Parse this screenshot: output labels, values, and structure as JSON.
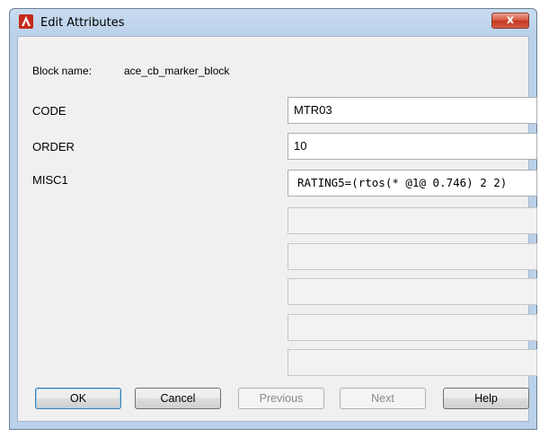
{
  "window": {
    "title": "Edit Attributes",
    "close_label": "x",
    "app_icon": "autocad-logo-icon"
  },
  "block": {
    "label": "Block name:",
    "value": "ace_cb_marker_block"
  },
  "attributes": [
    {
      "tag": "CODE",
      "value": "MTR03"
    },
    {
      "tag": "ORDER",
      "value": "10"
    },
    {
      "tag": "MISC1",
      "value": "RATING5=(rtos(* @1@ 0.746) 2 2)"
    }
  ],
  "buttons": {
    "ok": "OK",
    "cancel": "Cancel",
    "previous": "Previous",
    "next": "Next",
    "help": "Help"
  }
}
